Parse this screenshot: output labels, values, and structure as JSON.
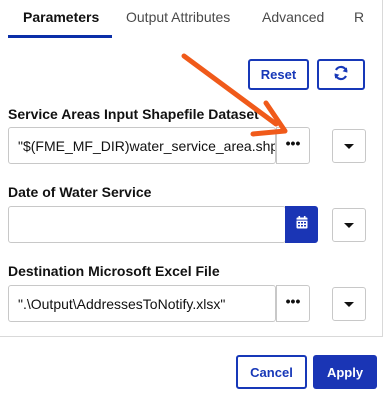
{
  "tabs": [
    {
      "label": "Parameters",
      "active": true
    },
    {
      "label": "Output Attributes",
      "active": false
    },
    {
      "label": "Advanced",
      "active": false
    },
    {
      "label": "R",
      "active": false
    }
  ],
  "toolbar": {
    "reset_label": "Reset",
    "refresh_icon": "refresh-icon"
  },
  "fields": {
    "service_areas": {
      "label": "Service Areas Input Shapefile Dataset",
      "value": "\"$(FME_MF_DIR)water_service_area.shp\"",
      "browse_icon": "ellipsis-icon",
      "dropdown_icon": "caret-down-icon"
    },
    "date": {
      "label": "Date of Water Service",
      "value": "",
      "picker_icon": "calendar-icon",
      "dropdown_icon": "caret-down-icon"
    },
    "destination": {
      "label": "Destination Microsoft Excel File",
      "value": "\".\\Output\\AddressesToNotify.xlsx\"",
      "browse_icon": "ellipsis-icon",
      "dropdown_icon": "caret-down-icon"
    }
  },
  "footer": {
    "cancel_label": "Cancel",
    "apply_label": "Apply"
  },
  "colors": {
    "accent": "#1a35b5",
    "annotation_arrow": "#f05a1a"
  }
}
